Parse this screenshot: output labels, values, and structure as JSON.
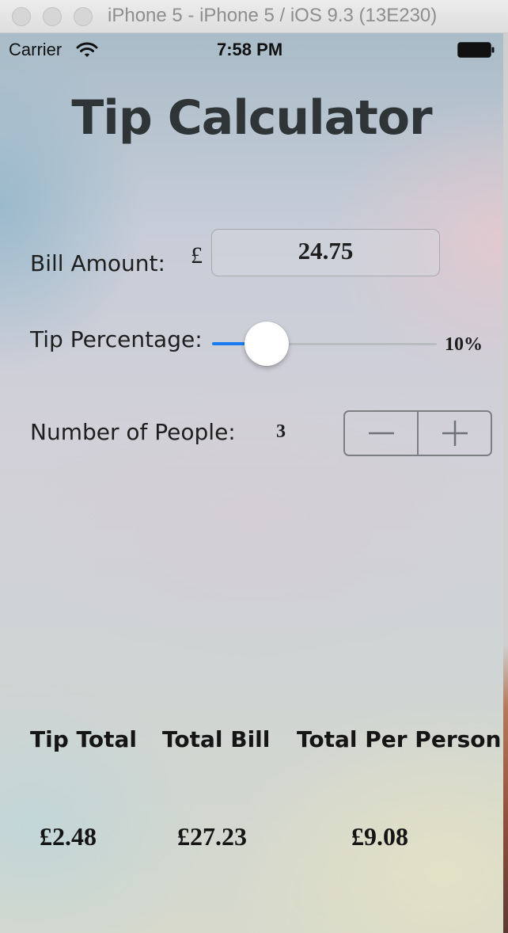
{
  "window": {
    "title": "iPhone 5 - iPhone 5 / iOS 9.3 (13E230)"
  },
  "status_bar": {
    "carrier": "Carrier",
    "time": "7:58 PM",
    "icons": [
      "wifi-icon",
      "battery-icon"
    ]
  },
  "app": {
    "title": "Tip Calculator",
    "bill": {
      "label": "Bill Amount:",
      "currency_symbol": "£",
      "value": "24.75"
    },
    "tip": {
      "label": "Tip Percentage:",
      "value_text": "10%",
      "slider_fraction": 0.18,
      "accent_color": "#1a7cf3"
    },
    "people": {
      "label": "Number of People:",
      "count": "3",
      "stepper_icons": [
        "minus-icon",
        "plus-icon"
      ]
    },
    "results": {
      "headers": {
        "tip_total": "Tip Total",
        "total_bill": "Total Bill",
        "total_per_person": "Total Per Person"
      },
      "values": {
        "tip_total": "£2.48",
        "total_bill": "£27.23",
        "total_per_person": "£9.08"
      }
    }
  }
}
